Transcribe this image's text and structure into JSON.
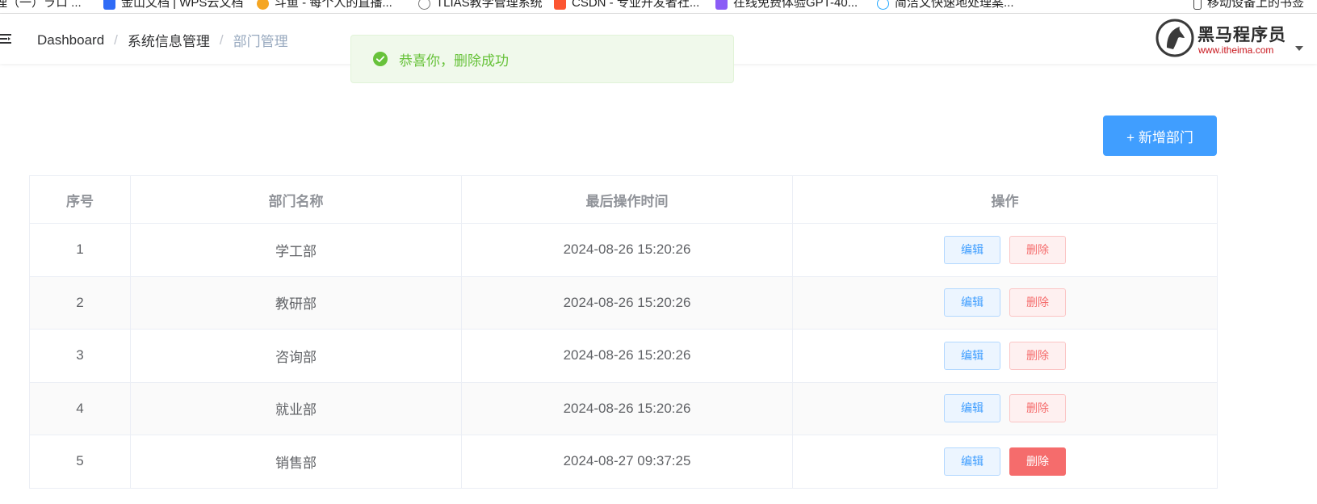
{
  "bookmarks": [
    {
      "label": "理（一）ラロ ...",
      "color": "#ffffff"
    },
    {
      "label": "金山文档 | WPS云文档",
      "color": "#2f6bf6"
    },
    {
      "label": "斗鱼 - 每个人的直播...",
      "color": "#f5a623"
    },
    {
      "label": "TLIAS教学管理系统",
      "color": "#777777"
    },
    {
      "label": "CSDN - 专业开发者社...",
      "color": "#fc5531"
    },
    {
      "label": "在线免费体验GPT-40...",
      "color": "#8b5cf6"
    },
    {
      "label": "简洁文快速地处理案...",
      "color": "#1fa6ff"
    },
    {
      "label": "移动设备上的书签",
      "color": "#444444"
    }
  ],
  "breadcrumb": [
    "Dashboard",
    "系统信息管理",
    "部门管理"
  ],
  "logo": {
    "title": "黑马程序员",
    "url": "www.itheima.com"
  },
  "toast": {
    "type": "success",
    "message": "恭喜你，删除成功"
  },
  "toolbar": {
    "add_label": "+ 新增部门"
  },
  "table": {
    "headers": [
      "序号",
      "部门名称",
      "最后操作时间",
      "操作"
    ],
    "rows": [
      {
        "index": "1",
        "name": "学工部",
        "time": "2024-08-26 15:20:26"
      },
      {
        "index": "2",
        "name": "教研部",
        "time": "2024-08-26 15:20:26"
      },
      {
        "index": "3",
        "name": "咨询部",
        "time": "2024-08-26 15:20:26"
      },
      {
        "index": "4",
        "name": "就业部",
        "time": "2024-08-26 15:20:26"
      },
      {
        "index": "5",
        "name": "销售部",
        "time": "2024-08-27 09:37:25"
      }
    ],
    "edit_label": "编辑",
    "delete_label": "删除"
  },
  "colors": {
    "primary": "#409eff",
    "success": "#67c23a",
    "danger": "#f56c6c",
    "breadcrumb_active": "#97a8be"
  }
}
